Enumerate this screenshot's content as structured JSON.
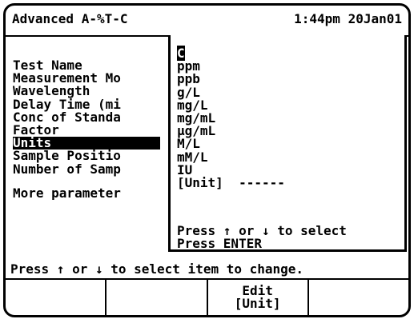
{
  "header": {
    "title": "Advanced A-%T-C",
    "clock": "1:44pm 20Jan01"
  },
  "parameters": [
    "Test Name",
    "Measurement Mo",
    "Wavelength",
    "Delay Time (mi",
    "Conc of Standa",
    "Factor",
    "Units",
    "Sample Positio",
    "Number of Samp"
  ],
  "more_parameters": "More parameter",
  "units_popup": {
    "options": [
      "C",
      "ppm",
      "ppb",
      "g/L",
      "mg/L",
      "mg/mL",
      "µg/mL",
      "M/L",
      "mM/L",
      "IU",
      "[Unit]  ------"
    ],
    "hint_line1": "Press ↑ or ↓ to select",
    "hint_line2": "Press ENTER"
  },
  "status": "Press ↑ or ↓ to select item to change.",
  "softkeys": [
    {
      "line1": "",
      "line2": ""
    },
    {
      "line1": "",
      "line2": ""
    },
    {
      "line1": "Edit",
      "line2": "[Unit]"
    },
    {
      "line1": "",
      "line2": ""
    }
  ]
}
